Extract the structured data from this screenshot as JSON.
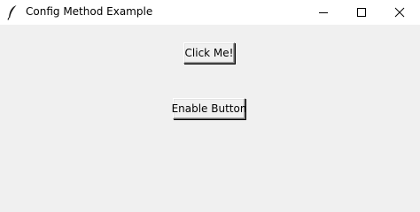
{
  "window": {
    "title": "Config Method Example",
    "icons": {
      "app": "feather-icon",
      "minimize": "minimize-icon",
      "maximize": "maximize-icon",
      "close": "close-icon"
    }
  },
  "buttons": {
    "click_me": "Click Me!",
    "enable": "Enable Button"
  }
}
